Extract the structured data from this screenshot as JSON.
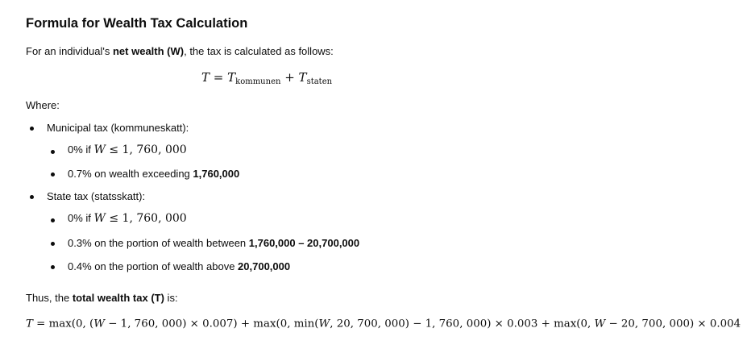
{
  "heading": "Formula for Wealth Tax Calculation",
  "intro": {
    "before": "For an individual's ",
    "bold": "net wealth (W)",
    "after": ", the tax is calculated as follows:"
  },
  "formula1": {
    "lhs": "T",
    "eq": " = ",
    "t1": "T",
    "t1_sub": "kommunen",
    "plus": " + ",
    "t2": "T",
    "t2_sub": "staten"
  },
  "where": "Where:",
  "municipal": {
    "title": "Municipal tax (kommuneskatt):",
    "item1": {
      "rate": "0% if ",
      "var": "W",
      "cond": " ≤ 1, 760, 000"
    },
    "item2": {
      "before": "0.7% on wealth exceeding ",
      "bold": "1,760,000"
    }
  },
  "state": {
    "title": "State tax (statsskatt):",
    "item1": {
      "rate": "0% if ",
      "var": "W",
      "cond": " ≤ 1, 760, 000"
    },
    "item2": {
      "before": "0.3% on the portion of wealth between ",
      "bold": "1,760,000 – 20,700,000"
    },
    "item3": {
      "before": "0.4% on the portion of wealth above ",
      "bold": "20,700,000"
    }
  },
  "thus": {
    "before": "Thus, the ",
    "bold": "total wealth tax (T)",
    "after": " is:"
  },
  "formula2": {
    "lhs": "T",
    "a": " = max(0, (",
    "w1": "W",
    "b": " − 1, 760, 000) × 0.007) + max(0, min(",
    "w2": "W",
    "c": ", 20, 700, 000) − 1, 760, 000) × 0.003 + max(0, ",
    "w3": "W",
    "d": " − 20, 700, 000) × 0.004"
  }
}
